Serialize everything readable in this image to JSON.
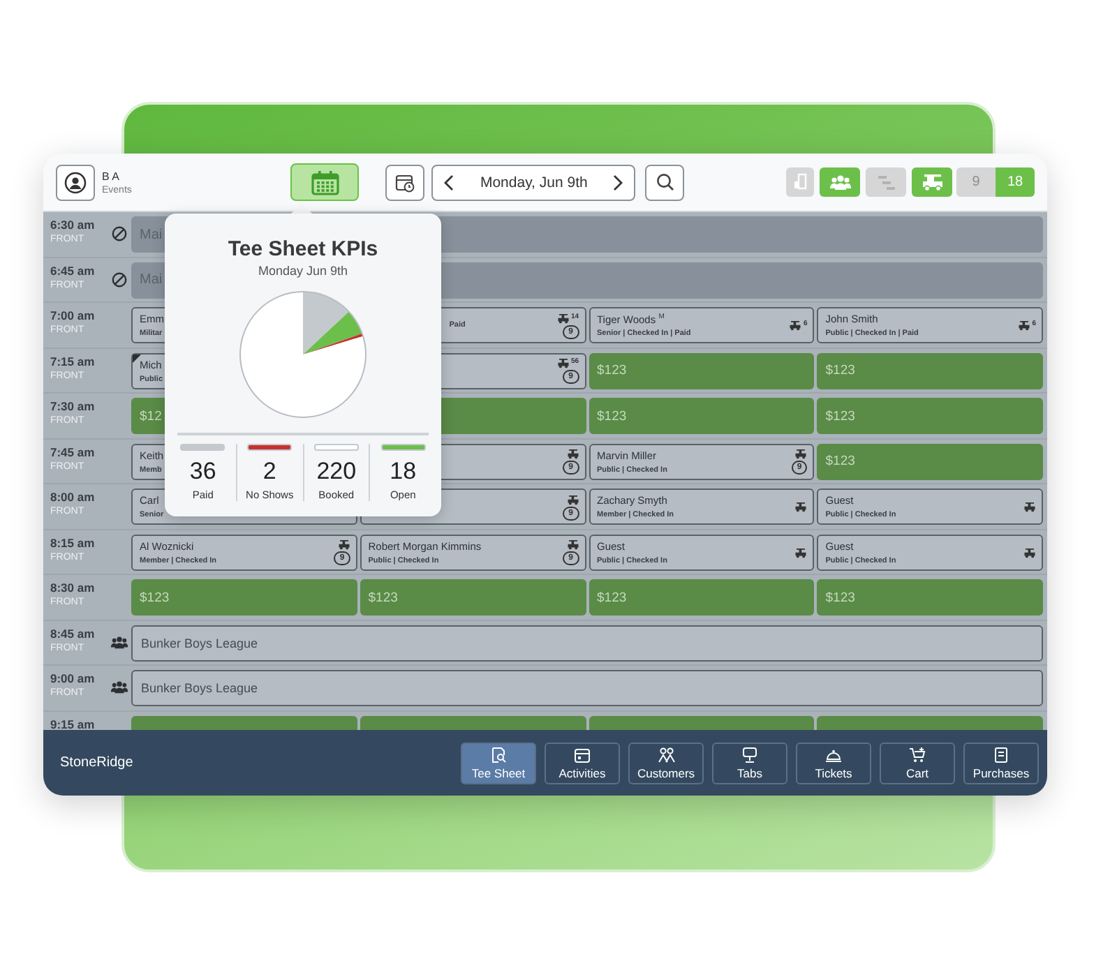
{
  "header": {
    "user": {
      "name": "B A",
      "role": "Events"
    },
    "kpi_button": {
      "active": true
    },
    "date": "Monday, Jun 9th",
    "toggles": [
      {
        "on": false
      },
      {
        "on": true
      },
      {
        "on": false
      },
      {
        "on": true
      }
    ],
    "holes": [
      {
        "label": "9",
        "selected": false
      },
      {
        "label": "18",
        "selected": true
      }
    ]
  },
  "tee_times": [
    {
      "time": "6:30 am",
      "side": "FRONT",
      "kind": "maintenance",
      "slots": [
        {
          "kind": "blocked",
          "text": "Mai"
        }
      ]
    },
    {
      "time": "6:45 am",
      "side": "FRONT",
      "kind": "maintenance",
      "slots": [
        {
          "kind": "blocked",
          "text": "Mai"
        }
      ]
    },
    {
      "time": "7:00 am",
      "side": "FRONT",
      "kind": "tee",
      "slots": [
        {
          "kind": "booked",
          "name": "Emm",
          "sub": "Militar"
        },
        {
          "kind": "booked",
          "covered": true,
          "sub": "Paid",
          "cart": true,
          "riders": "14",
          "badge": "9"
        },
        {
          "kind": "booked",
          "name": "Tiger Woods $^{M}$",
          "sub": "Senior | Checked In | Paid",
          "cart": true,
          "riders": "6"
        },
        {
          "kind": "booked",
          "name": "John Smith",
          "sub": "Public | Checked In | Paid",
          "cart": true,
          "riders": "6"
        }
      ]
    },
    {
      "time": "7:15 am",
      "side": "FRONT",
      "kind": "tee",
      "slots": [
        {
          "kind": "booked",
          "name": "Mich",
          "sub": "Public",
          "flag": true
        },
        {
          "kind": "booked",
          "cart": true,
          "riders": "56",
          "badge": "9"
        },
        {
          "kind": "open",
          "price": "$123"
        },
        {
          "kind": "open",
          "price": "$123"
        }
      ]
    },
    {
      "time": "7:30 am",
      "side": "FRONT",
      "kind": "tee",
      "slots": [
        {
          "kind": "open",
          "price": "$12"
        },
        {
          "kind": "open"
        },
        {
          "kind": "open",
          "price": "$123"
        },
        {
          "kind": "open",
          "price": "$123"
        }
      ]
    },
    {
      "time": "7:45 am",
      "side": "FRONT",
      "kind": "tee",
      "slots": [
        {
          "kind": "booked",
          "name": "Keith",
          "sub": "Memb"
        },
        {
          "kind": "booked",
          "cart": true,
          "badge": "9"
        },
        {
          "kind": "booked",
          "name": "Marvin Miller",
          "sub": "Public | Checked In",
          "cart": true,
          "badge": "9"
        },
        {
          "kind": "open",
          "price": "$123"
        }
      ]
    },
    {
      "time": "8:00 am",
      "side": "FRONT",
      "kind": "tee",
      "slots": [
        {
          "kind": "booked",
          "name": "Carl",
          "sub": "Senior"
        },
        {
          "kind": "booked",
          "cart": true,
          "badge": "9"
        },
        {
          "kind": "booked",
          "name": "Zachary Smyth",
          "sub": "Member | Checked In",
          "cart": true
        },
        {
          "kind": "booked",
          "name": "Guest",
          "sub": "Public | Checked In",
          "cart": true
        }
      ]
    },
    {
      "time": "8:15 am",
      "side": "FRONT",
      "kind": "tee",
      "slots": [
        {
          "kind": "booked",
          "name": "Al Woznicki",
          "sub": "Member | Checked In",
          "cart": true,
          "badge": "9"
        },
        {
          "kind": "booked",
          "name": "Robert Morgan Kimmins",
          "sub": "Public | Checked In",
          "cart": true,
          "badge": "9"
        },
        {
          "kind": "booked",
          "name": "Guest",
          "sub": "Public | Checked In",
          "cart": true
        },
        {
          "kind": "booked",
          "name": "Guest",
          "sub": "Public | Checked In",
          "cart": true
        }
      ]
    },
    {
      "time": "8:30 am",
      "side": "FRONT",
      "kind": "tee",
      "slots": [
        {
          "kind": "open",
          "price": "$123"
        },
        {
          "kind": "open",
          "price": "$123"
        },
        {
          "kind": "open",
          "price": "$123"
        },
        {
          "kind": "open",
          "price": "$123"
        }
      ]
    },
    {
      "time": "8:45 am",
      "side": "FRONT",
      "kind": "group",
      "slots": [
        {
          "kind": "group",
          "text": "Bunker Boys League"
        }
      ]
    },
    {
      "time": "9:00 am",
      "side": "FRONT",
      "kind": "group",
      "slots": [
        {
          "kind": "group",
          "text": "Bunker Boys League"
        }
      ]
    },
    {
      "time": "9:15 am",
      "kind": "tee",
      "slots": [
        {
          "kind": "open"
        },
        {
          "kind": "open"
        },
        {
          "kind": "open"
        },
        {
          "kind": "open"
        }
      ]
    }
  ],
  "kpi_popover": {
    "title": "Tee Sheet KPIs",
    "date": "Monday Jun 9th",
    "stats": [
      {
        "value": "36",
        "label": "Paid",
        "color": "#c4c9ce"
      },
      {
        "value": "2",
        "label": "No Shows",
        "color": "#c8302e"
      },
      {
        "value": "220",
        "label": "Booked",
        "color": "#ffffff"
      },
      {
        "value": "18",
        "label": "Open",
        "color": "#6cbf4a"
      }
    ]
  },
  "footer": {
    "brand": "StoneRidge",
    "tabs": [
      {
        "label": "Tee Sheet",
        "selected": true
      },
      {
        "label": "Activities",
        "selected": false
      },
      {
        "label": "Customers",
        "selected": false
      },
      {
        "label": "Tabs",
        "selected": false
      },
      {
        "label": "Tickets",
        "selected": false
      },
      {
        "label": "Cart",
        "selected": false
      },
      {
        "label": "Purchases",
        "selected": false
      }
    ]
  }
}
